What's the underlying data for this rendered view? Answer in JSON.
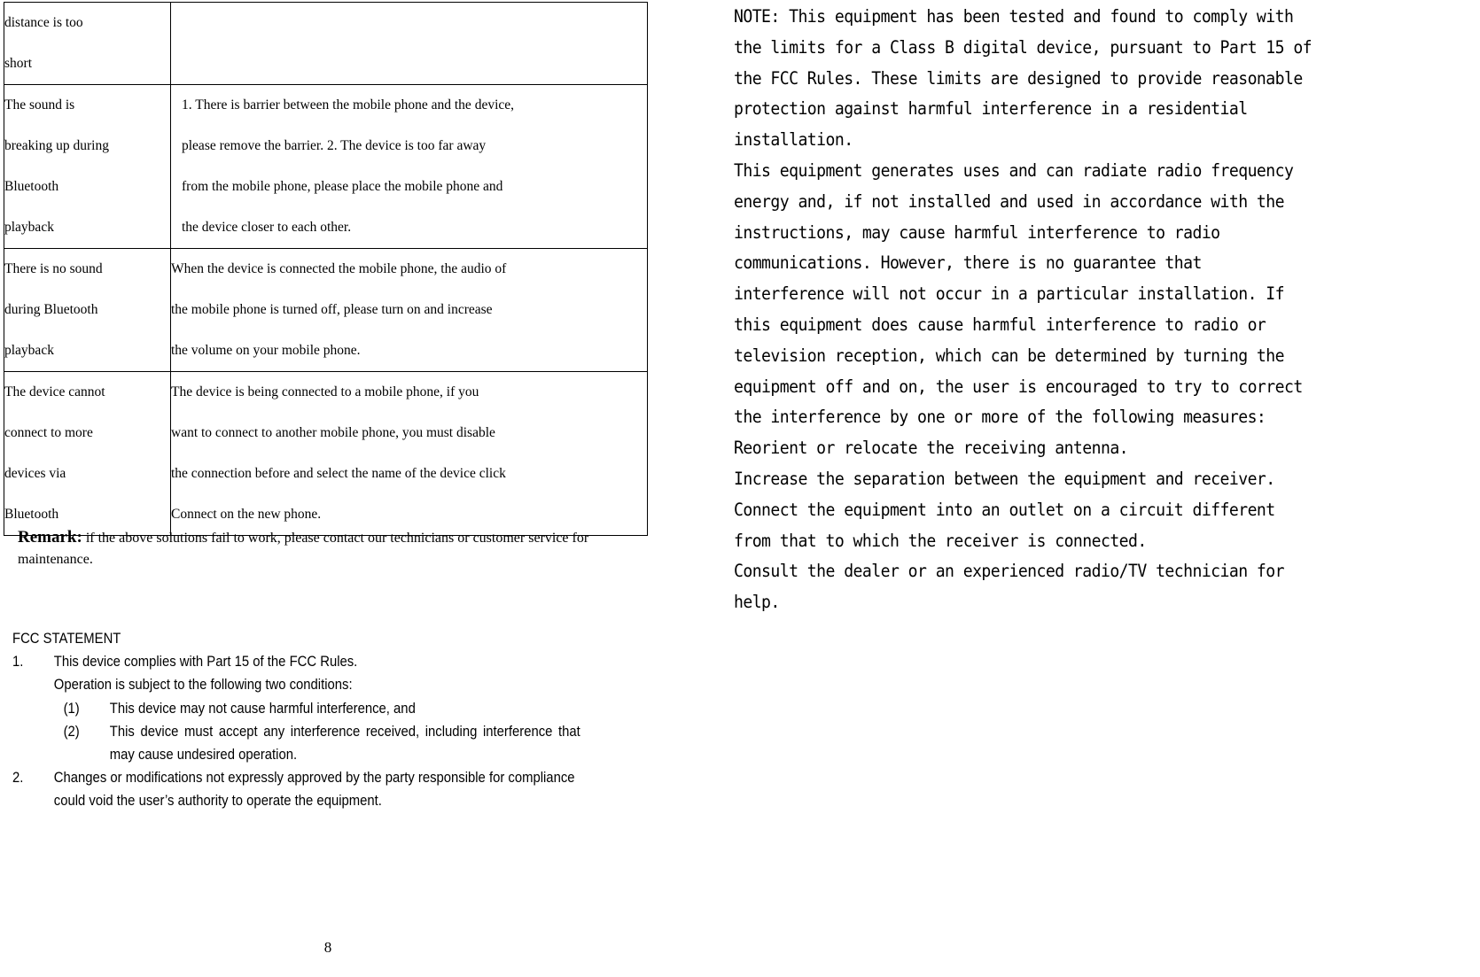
{
  "document": {
    "page_number": "8"
  },
  "table": {
    "rows": [
      {
        "symptom_lines": [
          "distance is too",
          "short"
        ],
        "solution_lines": []
      },
      {
        "symptom_lines": [
          "The sound is",
          "breaking up during",
          "Bluetooth",
          "playback"
        ],
        "solution_lines": [
          "1. There is barrier between the mobile phone and the device,",
          "please remove the barrier. 2. The device is too far away",
          "from the mobile phone, please place the mobile phone and",
          "the device closer to each other."
        ]
      },
      {
        "symptom_lines": [
          "There is no sound",
          "during Bluetooth",
          "playback"
        ],
        "solution_lines": [
          "When the device is connected the mobile phone, the audio of",
          "the mobile phone is turned off, please turn on and increase",
          "the volume on your mobile phone."
        ]
      },
      {
        "symptom_lines": [
          "The device cannot",
          "connect to more",
          "devices via",
          "Bluetooth"
        ],
        "solution_lines": [
          "The device is being connected to a mobile phone, if you",
          "want to connect to another mobile phone, you must disable",
          "the connection before and select the name of the device click",
          "Connect on the new phone."
        ]
      }
    ]
  },
  "remark": {
    "label": "Remark:",
    "text": "if the above solutions fail to work, please contact our technicians or customer service for maintenance."
  },
  "fcc": {
    "heading": "FCC STATEMENT",
    "item1": {
      "number": "1.",
      "line1": "This device complies with Part 15 of the FCC Rules.",
      "line2": "Operation is subject to the following two conditions:",
      "sub1_number": "(1)",
      "sub1_text": "This device may not cause harmful interference, and",
      "sub2_number": "(2)",
      "sub2_text": "This device must accept any interference received, including interference that may cause undesired operation."
    },
    "item2": {
      "number": "2.",
      "text": "Changes or modifications not expressly approved by the party responsible for compliance could void the user’s authority to operate the equipment."
    }
  },
  "note": {
    "paragraph1": [
      "NOTE: This equipment has been tested and found to comply with",
      "the limits for a Class B digital device, pursuant to Part 15 of",
      "the FCC Rules. These limits are designed to provide reasonable",
      "protection against harmful interference in a residential",
      "installation."
    ],
    "paragraph2": [
      "This equipment generates uses and can radiate radio frequency",
      "energy and, if not installed and used in accordance with the",
      "instructions, may cause harmful interference to radio",
      "communications. However, there is no guarantee that",
      "interference will not occur in a particular installation. If",
      "this equipment does cause harmful interference to radio or",
      "television reception, which can be determined by turning the",
      "equipment off and on, the user is encouraged to try to correct",
      "the interference by one or more of the following measures:"
    ],
    "measures": [
      "Reorient or relocate the receiving antenna.",
      "Increase the separation between the equipment and receiver.",
      "Connect the equipment into an outlet on a circuit different",
      "from that to which the receiver is connected.",
      "Consult the dealer or an experienced radio/TV technician for",
      "help."
    ]
  }
}
